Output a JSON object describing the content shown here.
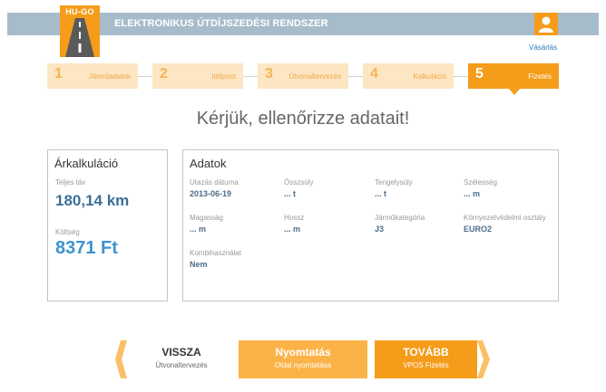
{
  "header": {
    "logo_text": "HU-GO",
    "title": "ELEKTRONIKUS ÚTDÍJSZEDÉSI RENDSZER",
    "purchase_link": "Vásárlás"
  },
  "steps": [
    {
      "num": "1",
      "label": "Járműadatok"
    },
    {
      "num": "2",
      "label": "Időpont"
    },
    {
      "num": "3",
      "label": "Útvonaltervezés"
    },
    {
      "num": "4",
      "label": "Kalkuláció"
    },
    {
      "num": "5",
      "label": "Fizetés"
    }
  ],
  "active_step": 5,
  "main_title": "Kérjük, ellenőrizze adatait!",
  "calc": {
    "title": "Árkalkuláció",
    "distance_label": "Teljes táv",
    "distance_value": "180,14 km",
    "cost_label": "Költség",
    "cost_value": "8371 Ft"
  },
  "data": {
    "title": "Adatok",
    "fields": [
      {
        "label": "Utazás dátuma",
        "value": "2013-06-19"
      },
      {
        "label": "Összsúly",
        "value": "... t"
      },
      {
        "label": "Tengelysúly",
        "value": "... t"
      },
      {
        "label": "Szélesség",
        "value": "... m"
      },
      {
        "label": "Magasság",
        "value": "... m"
      },
      {
        "label": "Hossz",
        "value": "... m"
      },
      {
        "label": "Járműkategória",
        "value": "J3"
      },
      {
        "label": "Környezetvédelmi osztály",
        "value": "EURO2"
      },
      {
        "label": "Kombihasználat",
        "value": "Nem"
      }
    ]
  },
  "buttons": {
    "back": {
      "title": "VISSZA",
      "sub": "Útvonaltervezés"
    },
    "print": {
      "title": "Nyomtatás",
      "sub": "Oldal nyomtatása"
    },
    "next": {
      "title": "TOVÁBB",
      "sub": "VPOS Fizetés"
    }
  },
  "colors": {
    "accent": "#f59c1a",
    "header_bar": "#a7bccb",
    "step_inactive": "#fde6c4",
    "link": "#2f79b9"
  }
}
